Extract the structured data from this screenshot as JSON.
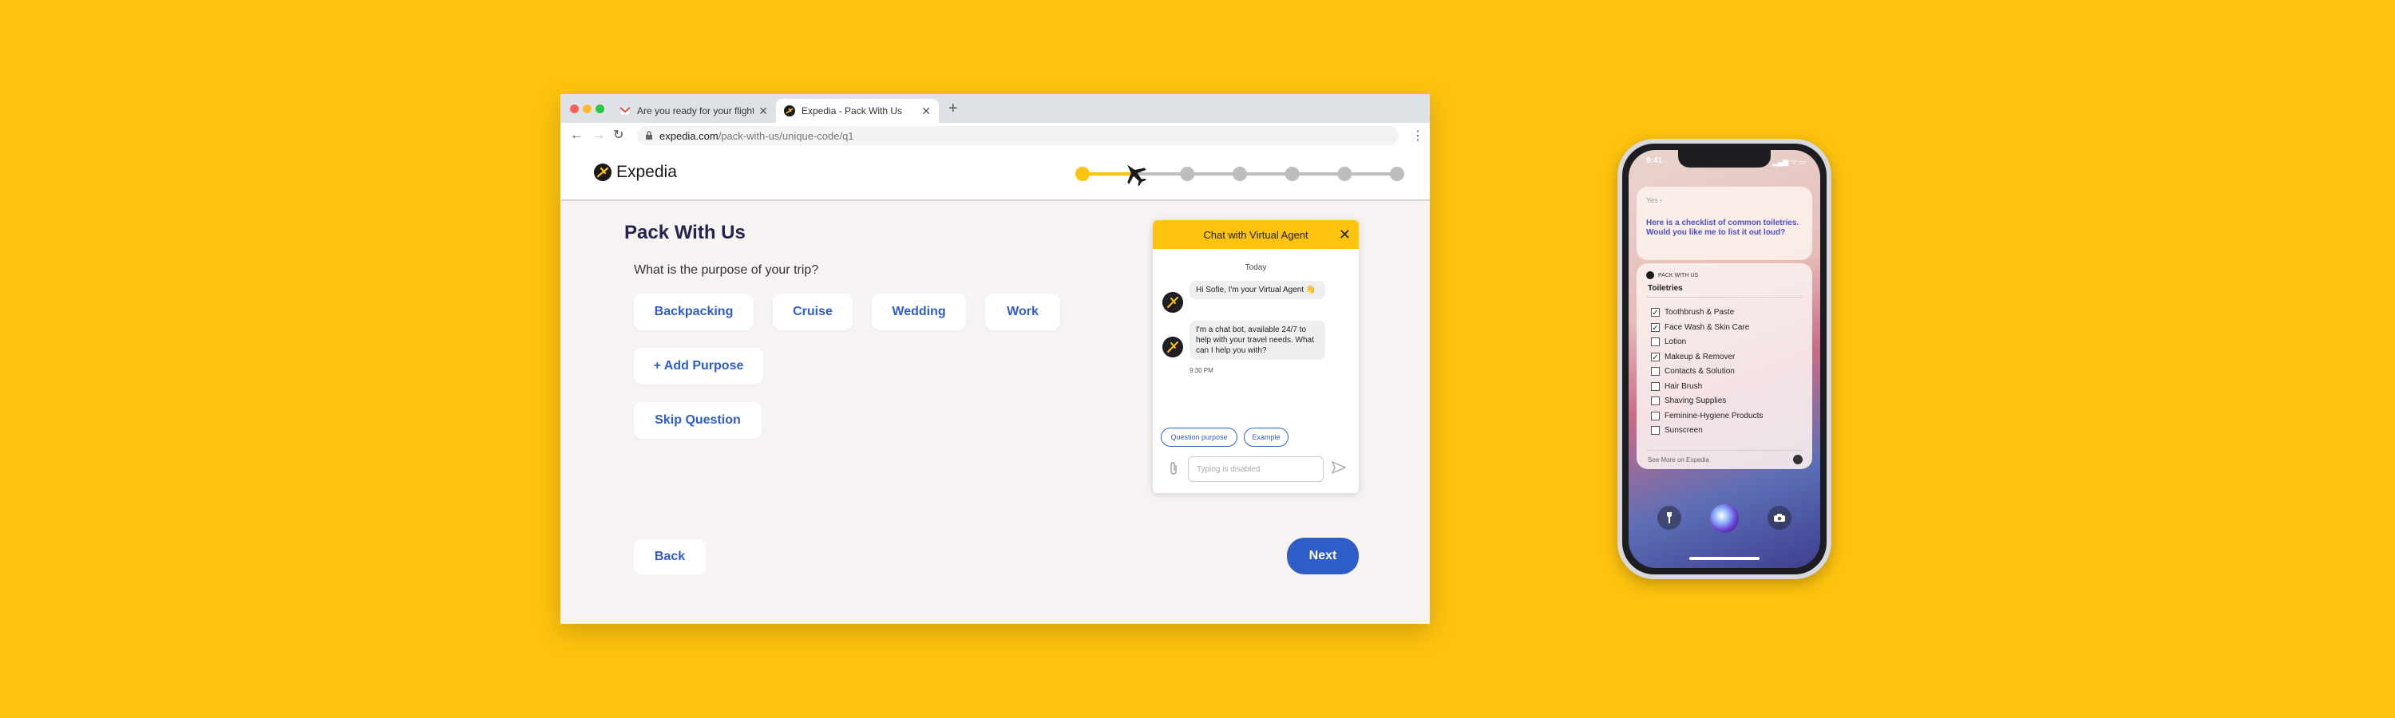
{
  "browser": {
    "tabs": [
      {
        "title": "Are you ready for your flight?",
        "icon": "gmail-icon"
      },
      {
        "title": "Expedia - Pack With Us",
        "icon": "expedia-icon"
      }
    ],
    "url_host": "expedia.com",
    "url_path": "/pack-with-us/unique-code/q1"
  },
  "site": {
    "logo_text": "Expedia",
    "progress": {
      "total_steps": 7,
      "current_step": 2
    }
  },
  "main": {
    "title": "Pack With Us",
    "question": "What is the purpose of your trip?",
    "options": [
      "Backpacking",
      "Cruise",
      "Wedding",
      "Work"
    ],
    "add_label": "+ Add Purpose",
    "skip_label": "Skip Question",
    "back_label": "Back",
    "next_label": "Next"
  },
  "chat": {
    "title": "Chat with Virtual Agent",
    "day": "Today",
    "messages": [
      "Hi Sofie, I'm your Virtual Agent 👋",
      "I'm a chat bot, available 24/7 to help with your travel needs. What can I help you with?"
    ],
    "time": "9:30 PM",
    "quick_replies": [
      "Question purpose",
      "Example"
    ],
    "input_placeholder": "Typing is disabled"
  },
  "phone": {
    "time": "9:41",
    "status": "▂▄▆ ᯤ ▭",
    "siri_said": "Yes ›",
    "siri_response": "Here is a checklist of common toiletries. Would you like me to list it out loud?",
    "app_name": "PACK WITH US",
    "list_title": "Toiletries",
    "items": [
      {
        "label": "Toothbrush & Paste",
        "checked": true
      },
      {
        "label": "Face Wash & Skin Care",
        "checked": true
      },
      {
        "label": "Lotion",
        "checked": false
      },
      {
        "label": "Makeup & Remover",
        "checked": true
      },
      {
        "label": "Contacts & Solution",
        "checked": false
      },
      {
        "label": "Hair Brush",
        "checked": false
      },
      {
        "label": "Shaving Supplies",
        "checked": false
      },
      {
        "label": "Feminine-Hygiene Products",
        "checked": false
      },
      {
        "label": "Sunscreen",
        "checked": false
      }
    ],
    "footer": "See More on Expedia"
  },
  "colors": {
    "background": "#FEC30E",
    "accent_blue": "#2F5DC8",
    "navy_title": "#23254D",
    "progress_active": "#FEC30E",
    "progress_inactive": "#BDBDBD"
  }
}
